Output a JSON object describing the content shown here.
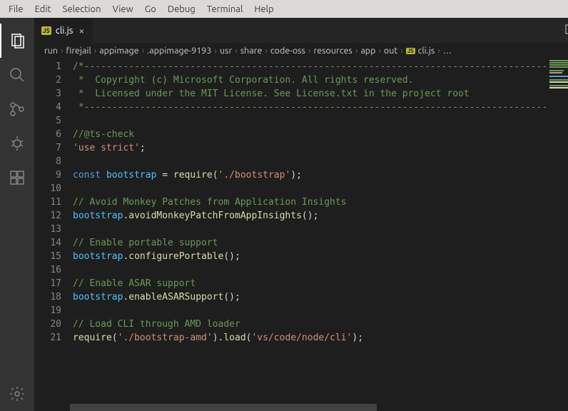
{
  "menubar": [
    "File",
    "Edit",
    "Selection",
    "View",
    "Go",
    "Debug",
    "Terminal",
    "Help"
  ],
  "activity": [
    "explorer",
    "search",
    "scm",
    "debug",
    "extensions"
  ],
  "tab": {
    "badge": "JS",
    "filename": "cli.js"
  },
  "breadcrumb": [
    "run",
    "firejail",
    "appimage",
    ".appimage-9193",
    "usr",
    "share",
    "code-oss",
    "resources",
    "app",
    "out"
  ],
  "breadcrumb_file": {
    "badge": "JS",
    "name": "cli.js"
  },
  "breadcrumb_tail": "…",
  "line_count": 21,
  "code": {
    "l1": "/*---------------------------------------------------------------------------------------------",
    "l2": " *  Copyright (c) Microsoft Corporation. All rights reserved.",
    "l3": " *  Licensed under the MIT License. See License.txt in the project root",
    "l4": " *--------------------------------------------------------------------------------------------",
    "l6": "//@ts-check",
    "l7_str": "'use strict'",
    "l7_semi": ";",
    "l9_kw": "const",
    "l9_var": "bootstrap",
    "l9_eq": " = ",
    "l9_fn": "require",
    "l9_open": "(",
    "l9_arg": "'./bootstrap'",
    "l9_close": ");",
    "l11": "// Avoid Monkey Patches from Application Insights",
    "l12_obj": "bootstrap",
    "l12_dot": ".",
    "l12_fn": "avoidMonkeyPatchFromAppInsights",
    "l12_call": "();",
    "l14": "// Enable portable support",
    "l15_obj": "bootstrap",
    "l15_dot": ".",
    "l15_fn": "configurePortable",
    "l15_call": "();",
    "l17": "// Enable ASAR support",
    "l18_obj": "bootstrap",
    "l18_dot": ".",
    "l18_fn": "enableASARSupport",
    "l18_call": "();",
    "l20": "// Load CLI through AMD loader",
    "l21_fn1": "require",
    "l21_open1": "(",
    "l21_arg1": "'./bootstrap-amd'",
    "l21_close1": ").",
    "l21_fn2": "load",
    "l21_open2": "(",
    "l21_arg2": "'vs/code/node/cli'",
    "l21_close2": ");"
  }
}
